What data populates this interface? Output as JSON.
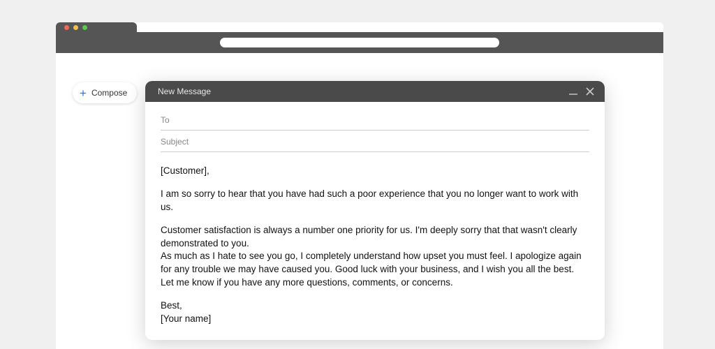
{
  "compose": {
    "label": "Compose"
  },
  "dialog": {
    "title": "New Message",
    "to_label": "To",
    "subject_label": "Subject",
    "body": {
      "greeting": "[Customer],",
      "p1": "I am so sorry to hear that you have had such a poor experience that you no longer want to work with us.",
      "p2a": "Customer satisfaction is always a number one priority for us. I'm deeply sorry that that wasn't clearly demonstrated to you.",
      "p2b": "As much as I hate to see you go, I completely understand how upset you must feel. I apologize again for any trouble we may have caused you. Good luck with your business, and I wish you all the best. Let me know if you have any more questions, comments, or concerns.",
      "signoff": "Best,",
      "name": "[Your name]"
    }
  }
}
